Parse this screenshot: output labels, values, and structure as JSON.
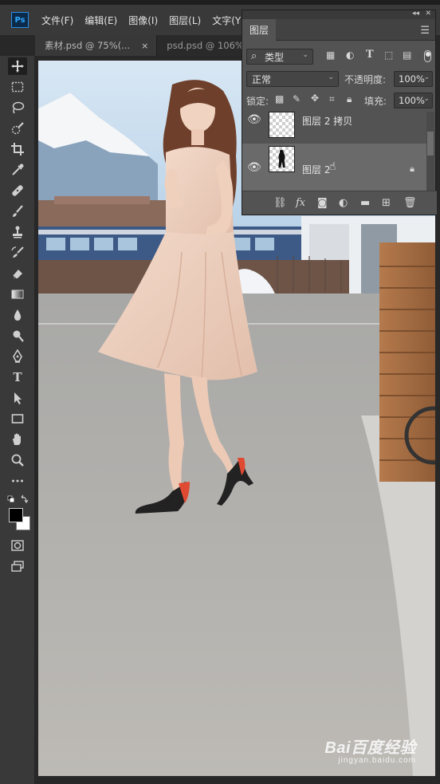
{
  "app": {
    "logo": "Ps"
  },
  "menu": [
    "文件(F)",
    "编辑(E)",
    "图像(I)",
    "图层(L)",
    "文字(Y)"
  ],
  "tabs": [
    {
      "title": "素材.psd @ 75%(...",
      "close": "×"
    },
    {
      "title": "psd.psd @ 106% (...",
      "close": ""
    }
  ],
  "tools": [
    "move-icon",
    "marquee-icon",
    "lasso-icon",
    "quick-select-icon",
    "crop-icon",
    "eyedropper-icon",
    "healing-icon",
    "brush-icon",
    "stamp-icon",
    "history-brush-icon",
    "eraser-icon",
    "gradient-icon",
    "blur-icon",
    "dodge-icon",
    "pen-icon",
    "type-icon",
    "path-select-icon",
    "rectangle-icon",
    "hand-icon",
    "zoom-icon",
    "more-icon"
  ],
  "layers_panel": {
    "title": "图层",
    "filter_label": "类型",
    "blend_mode": "正常",
    "opacity_label": "不透明度:",
    "opacity_value": "100%",
    "lock_label": "锁定:",
    "fill_label": "填充:",
    "fill_value": "100%",
    "layers": [
      {
        "name": "图层 2 拷贝",
        "visible": true,
        "selected": false,
        "locked": false
      },
      {
        "name": "图层 2",
        "visible": true,
        "selected": true,
        "locked": true
      }
    ]
  },
  "watermark": {
    "brand": "Bai百度经验",
    "site": "jingyan.baidu.com"
  },
  "colors": {
    "accent": "#31a8ff",
    "foreground": "#000000",
    "background": "#ffffff"
  }
}
